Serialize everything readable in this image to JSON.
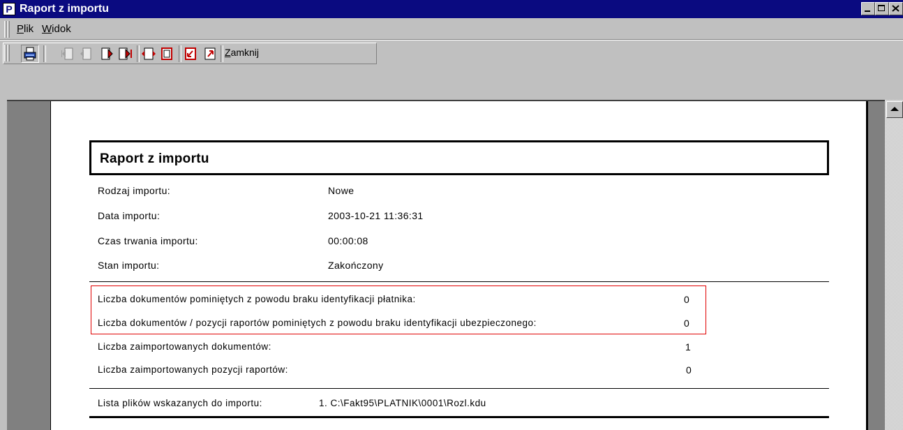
{
  "window": {
    "title": "Raport z importu",
    "app_icon_letter": "P",
    "controls": [
      "minimize-icon",
      "maximize-icon",
      "close-icon"
    ]
  },
  "menubar": {
    "items": [
      {
        "first": "P",
        "rest": "lik"
      },
      {
        "first": "W",
        "rest": "idok"
      }
    ]
  },
  "toolbar": {
    "buttons": [
      "printer-icon",
      "first-page-icon",
      "previous-page-icon",
      "next-page-icon",
      "last-page-icon",
      "page-width-icon",
      "whole-page-icon",
      "zoom-in-icon",
      "zoom-out-icon"
    ],
    "close_first": "Z",
    "close_rest": "amknij"
  },
  "report": {
    "title": "Raport z importu",
    "fields": [
      {
        "label": "Rodzaj importu:",
        "value": "Nowe"
      },
      {
        "label": "Data importu:",
        "value": "2003-10-21 11:36:31"
      },
      {
        "label": "Czas trwania importu:",
        "value": "00:00:08"
      },
      {
        "label": "Stan importu:",
        "value": "Zakończony"
      }
    ],
    "counts": [
      {
        "label": "Liczba dokumentów pominiętych z powodu braku identyfikacji płatnika:",
        "value": "0"
      },
      {
        "label": "Liczba dokumentów / pozycji raportów pominiętych z powodu braku identyfikacji ubezpieczonego:",
        "value": "0"
      },
      {
        "label": "Liczba zaimportowanych dokumentów:",
        "value": "1"
      },
      {
        "label": "Liczba zaimportowanych pozycji raportów:",
        "value": "0"
      }
    ],
    "files_label": "Lista plików wskazanych do importu:",
    "files_value": "1. C:\\Fakt95\\PLATNIK\\0001\\Rozl.kdu"
  },
  "colors": {
    "title_bar": "#0a0a80",
    "highlight_border": "#e00000",
    "chrome": "#c0c0c0",
    "workspace": "#808080"
  }
}
